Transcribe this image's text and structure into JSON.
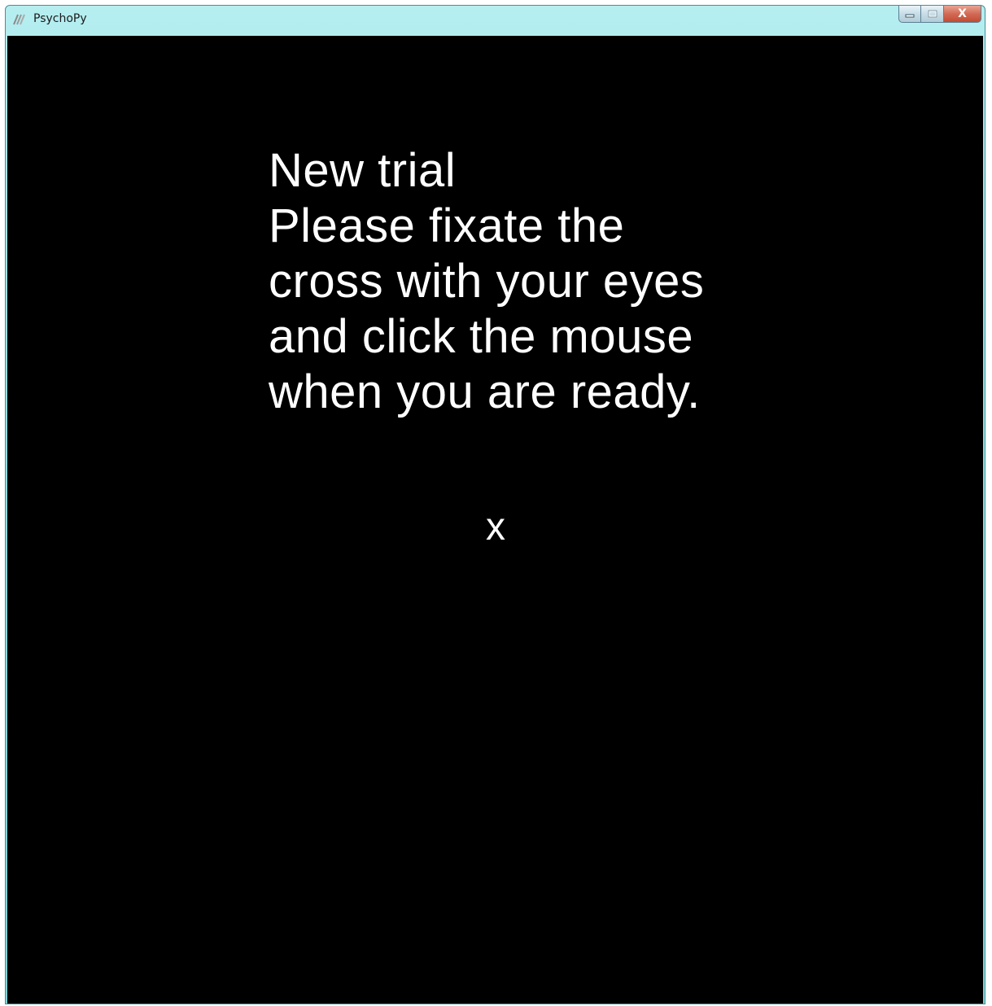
{
  "window": {
    "title": "PsychoPy",
    "app_icon": "psychopy-icon",
    "caption": {
      "minimize_icon": "minimize-icon",
      "maximize_icon": "maximize-icon",
      "close_icon": "close-icon",
      "close_glyph": "X"
    }
  },
  "stimulus": {
    "background_color": "#000000",
    "text_color": "#ffffff",
    "instruction_lines": [
      "New trial",
      "Please fixate the",
      "cross with your eyes",
      "and click the mouse",
      "when you are ready."
    ],
    "fixation_mark": "x"
  }
}
